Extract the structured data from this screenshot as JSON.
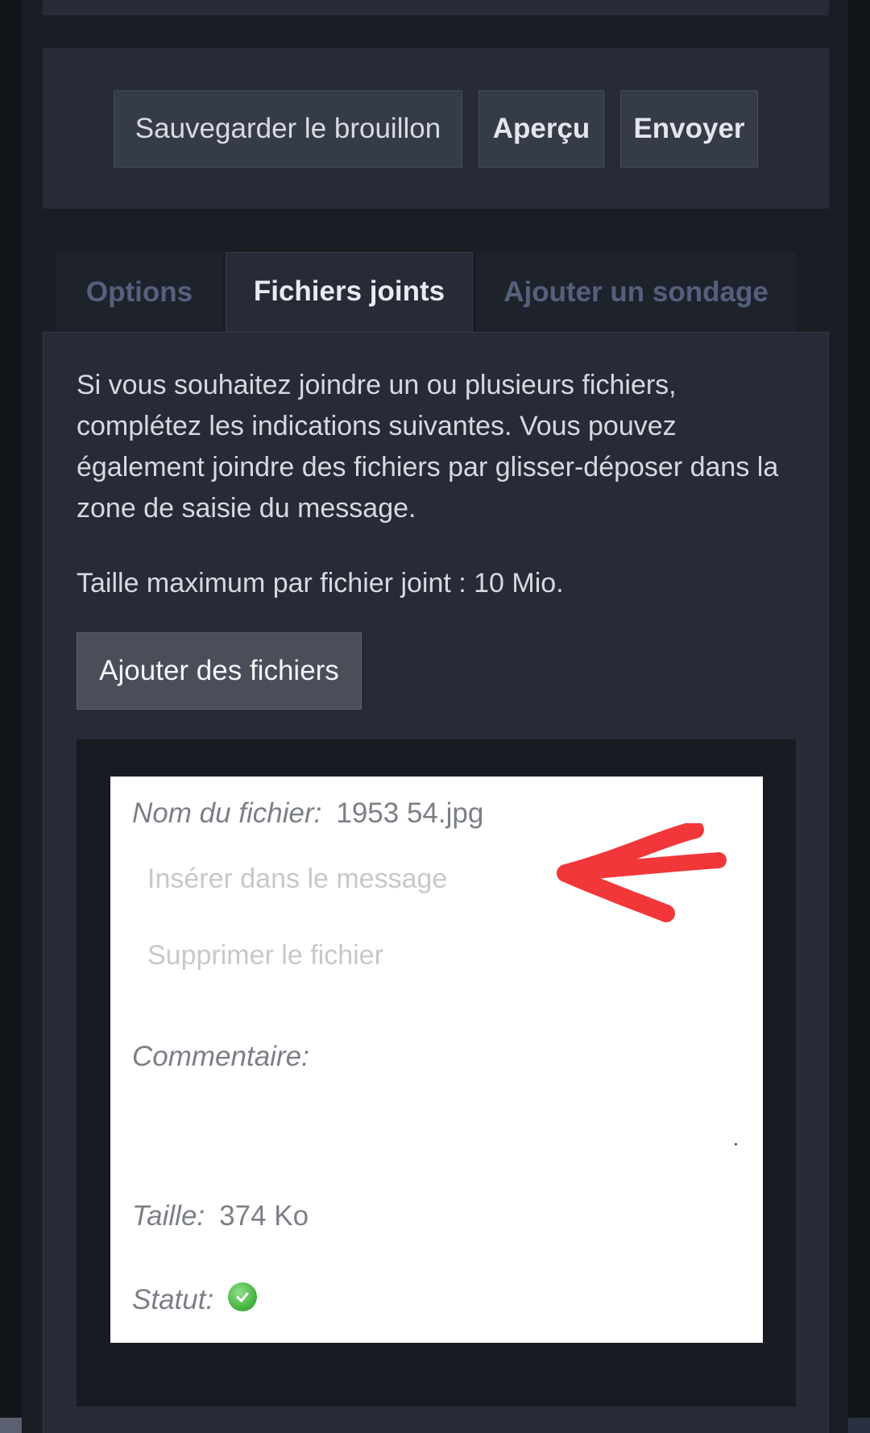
{
  "actions": {
    "save_draft_label": "Sauvegarder le brouillon",
    "preview_label": "Aperçu",
    "send_label": "Envoyer"
  },
  "tabs": [
    {
      "label": "Options",
      "active": false
    },
    {
      "label": "Fichiers joints",
      "active": true
    },
    {
      "label": "Ajouter un sondage",
      "active": false
    }
  ],
  "attachments": {
    "intro_text": "Si vous souhaitez joindre un ou plusieurs fichiers, complétez les indications suivantes. Vous pouvez également joindre des fichiers par glisser-déposer dans la zone de saisie du message.",
    "max_size_text": "Taille maximum par fichier joint : 10 Mio.",
    "add_files_label": "Ajouter des fichiers",
    "file": {
      "name_label": "Nom du fichier:",
      "name_value": "1953 54.jpg",
      "insert_label": "Insérer dans le message",
      "delete_label": "Supprimer le fichier",
      "comment_label": "Commentaire:",
      "size_label": "Taille:",
      "size_value": "374 Ko",
      "status_label": "Statut:",
      "status_icon": "check-circle-icon"
    }
  },
  "annotation": {
    "icon": "red-arrow-annotation",
    "color": "#f2373a"
  },
  "colors": {
    "background": "#1a1d24",
    "panel": "#272b37",
    "button": "#363b48",
    "inactive_tab_text": "#55617c",
    "status_green": "#3fae3a"
  }
}
